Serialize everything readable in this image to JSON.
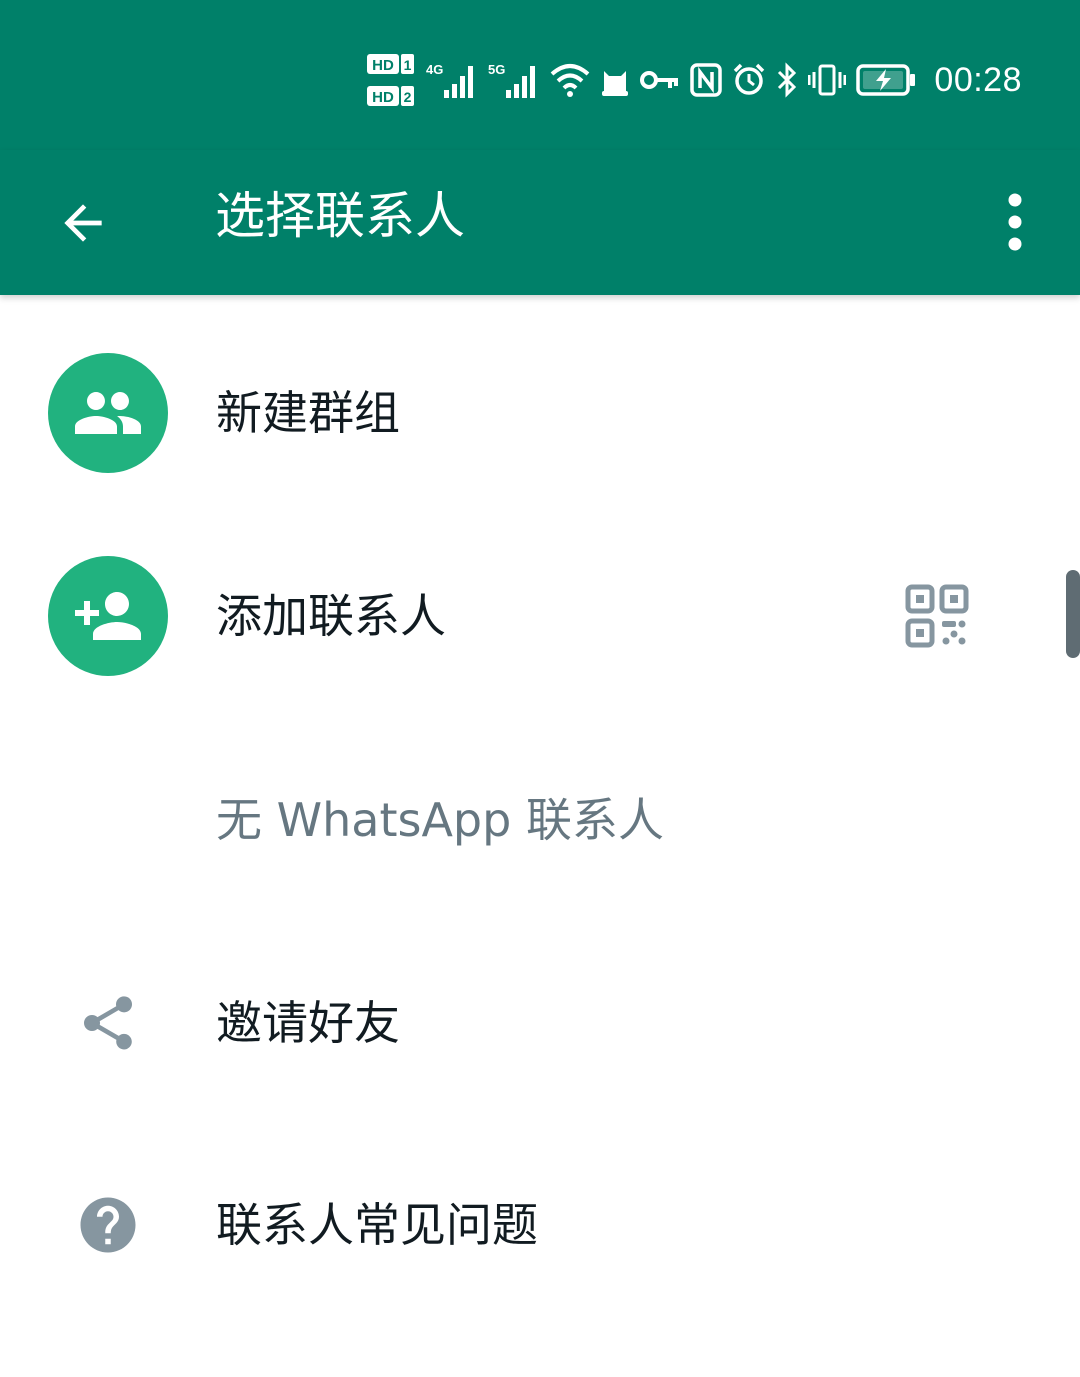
{
  "status_bar": {
    "time": "00:28",
    "sim1_label": "HD",
    "sim1_slot": "1",
    "sim2_label": "HD",
    "sim2_slot": "2",
    "net1_label": "4G",
    "net2_label": "5G",
    "icons": [
      "signal-icon",
      "wifi-icon",
      "cat-icon",
      "key-icon",
      "nfc-icon",
      "alarm-icon",
      "bluetooth-icon",
      "vibrate-icon",
      "battery-charging-icon"
    ]
  },
  "app_bar": {
    "title": "选择联系人",
    "back_icon": "arrow-left-icon",
    "menu_icon": "more-vertical-icon"
  },
  "list": {
    "new_group": "新建群组",
    "add_contact": "添加联系人",
    "no_contacts": "无 WhatsApp 联系人",
    "invite_friends": "邀请好友",
    "contacts_help": "联系人常见问题"
  },
  "colors": {
    "brand": "#008069",
    "accent": "#21b27f",
    "text_primary": "#111b21",
    "text_secondary": "#667781",
    "icon_gray": "#8696a0"
  }
}
